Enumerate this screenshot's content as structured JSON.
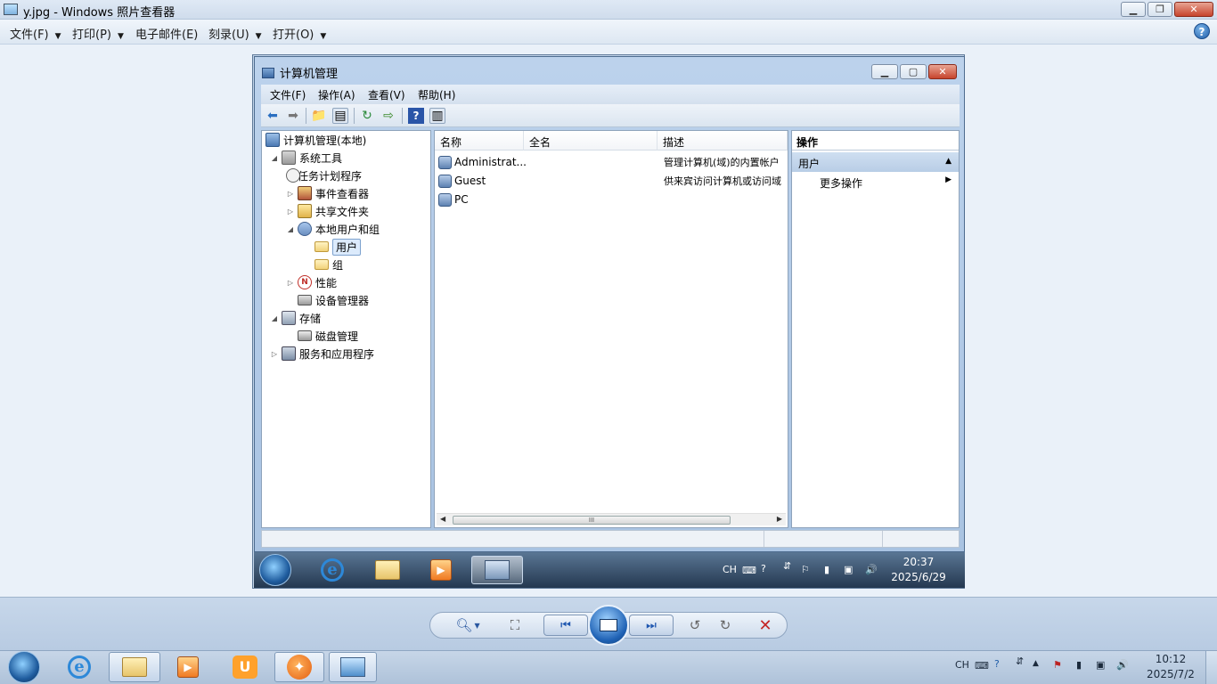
{
  "viewer": {
    "title": "y.jpg - Windows 照片查看器",
    "menu": [
      "文件(F)",
      "打印(P)",
      "电子邮件(E)",
      "刻录(U)",
      "打开(O)"
    ],
    "help_glyph": "?"
  },
  "cm": {
    "title": "计算机管理",
    "menu": [
      "文件(F)",
      "操作(A)",
      "查看(V)",
      "帮助(H)"
    ],
    "tree": [
      {
        "label": "计算机管理(本地)",
        "icon": "computer-icon"
      },
      {
        "label": "系统工具",
        "icon": "tools-icon"
      },
      {
        "label": "任务计划程序",
        "icon": "clock-icon"
      },
      {
        "label": "事件查看器",
        "icon": "event-viewer-icon"
      },
      {
        "label": "共享文件夹",
        "icon": "shared-folder-icon"
      },
      {
        "label": "本地用户和组",
        "icon": "users-icon"
      },
      {
        "label": "用户",
        "icon": "folder-icon"
      },
      {
        "label": "组",
        "icon": "folder-icon"
      },
      {
        "label": "性能",
        "icon": "performance-icon"
      },
      {
        "label": "设备管理器",
        "icon": "device-manager-icon"
      },
      {
        "label": "存储",
        "icon": "storage-icon"
      },
      {
        "label": "磁盘管理",
        "icon": "disk-icon"
      },
      {
        "label": "服务和应用程序",
        "icon": "services-icon"
      }
    ],
    "columns": [
      "名称",
      "全名",
      "描述"
    ],
    "users": [
      {
        "name": "Administrat...",
        "fullname": "",
        "desc": "管理计算机(域)的内置帐户"
      },
      {
        "name": "Guest",
        "fullname": "",
        "desc": "供来宾访问计算机或访问域"
      },
      {
        "name": "PC",
        "fullname": "",
        "desc": ""
      }
    ],
    "actions": {
      "header": "操作",
      "section": "用户",
      "more": "更多操作"
    },
    "scroll_grip": "III"
  },
  "inner_tray": {
    "lang": "CH",
    "time": "20:37",
    "date": "2025/6/29"
  },
  "host_tray": {
    "lang": "CH",
    "time": "10:12",
    "date": "2025/7/2"
  }
}
